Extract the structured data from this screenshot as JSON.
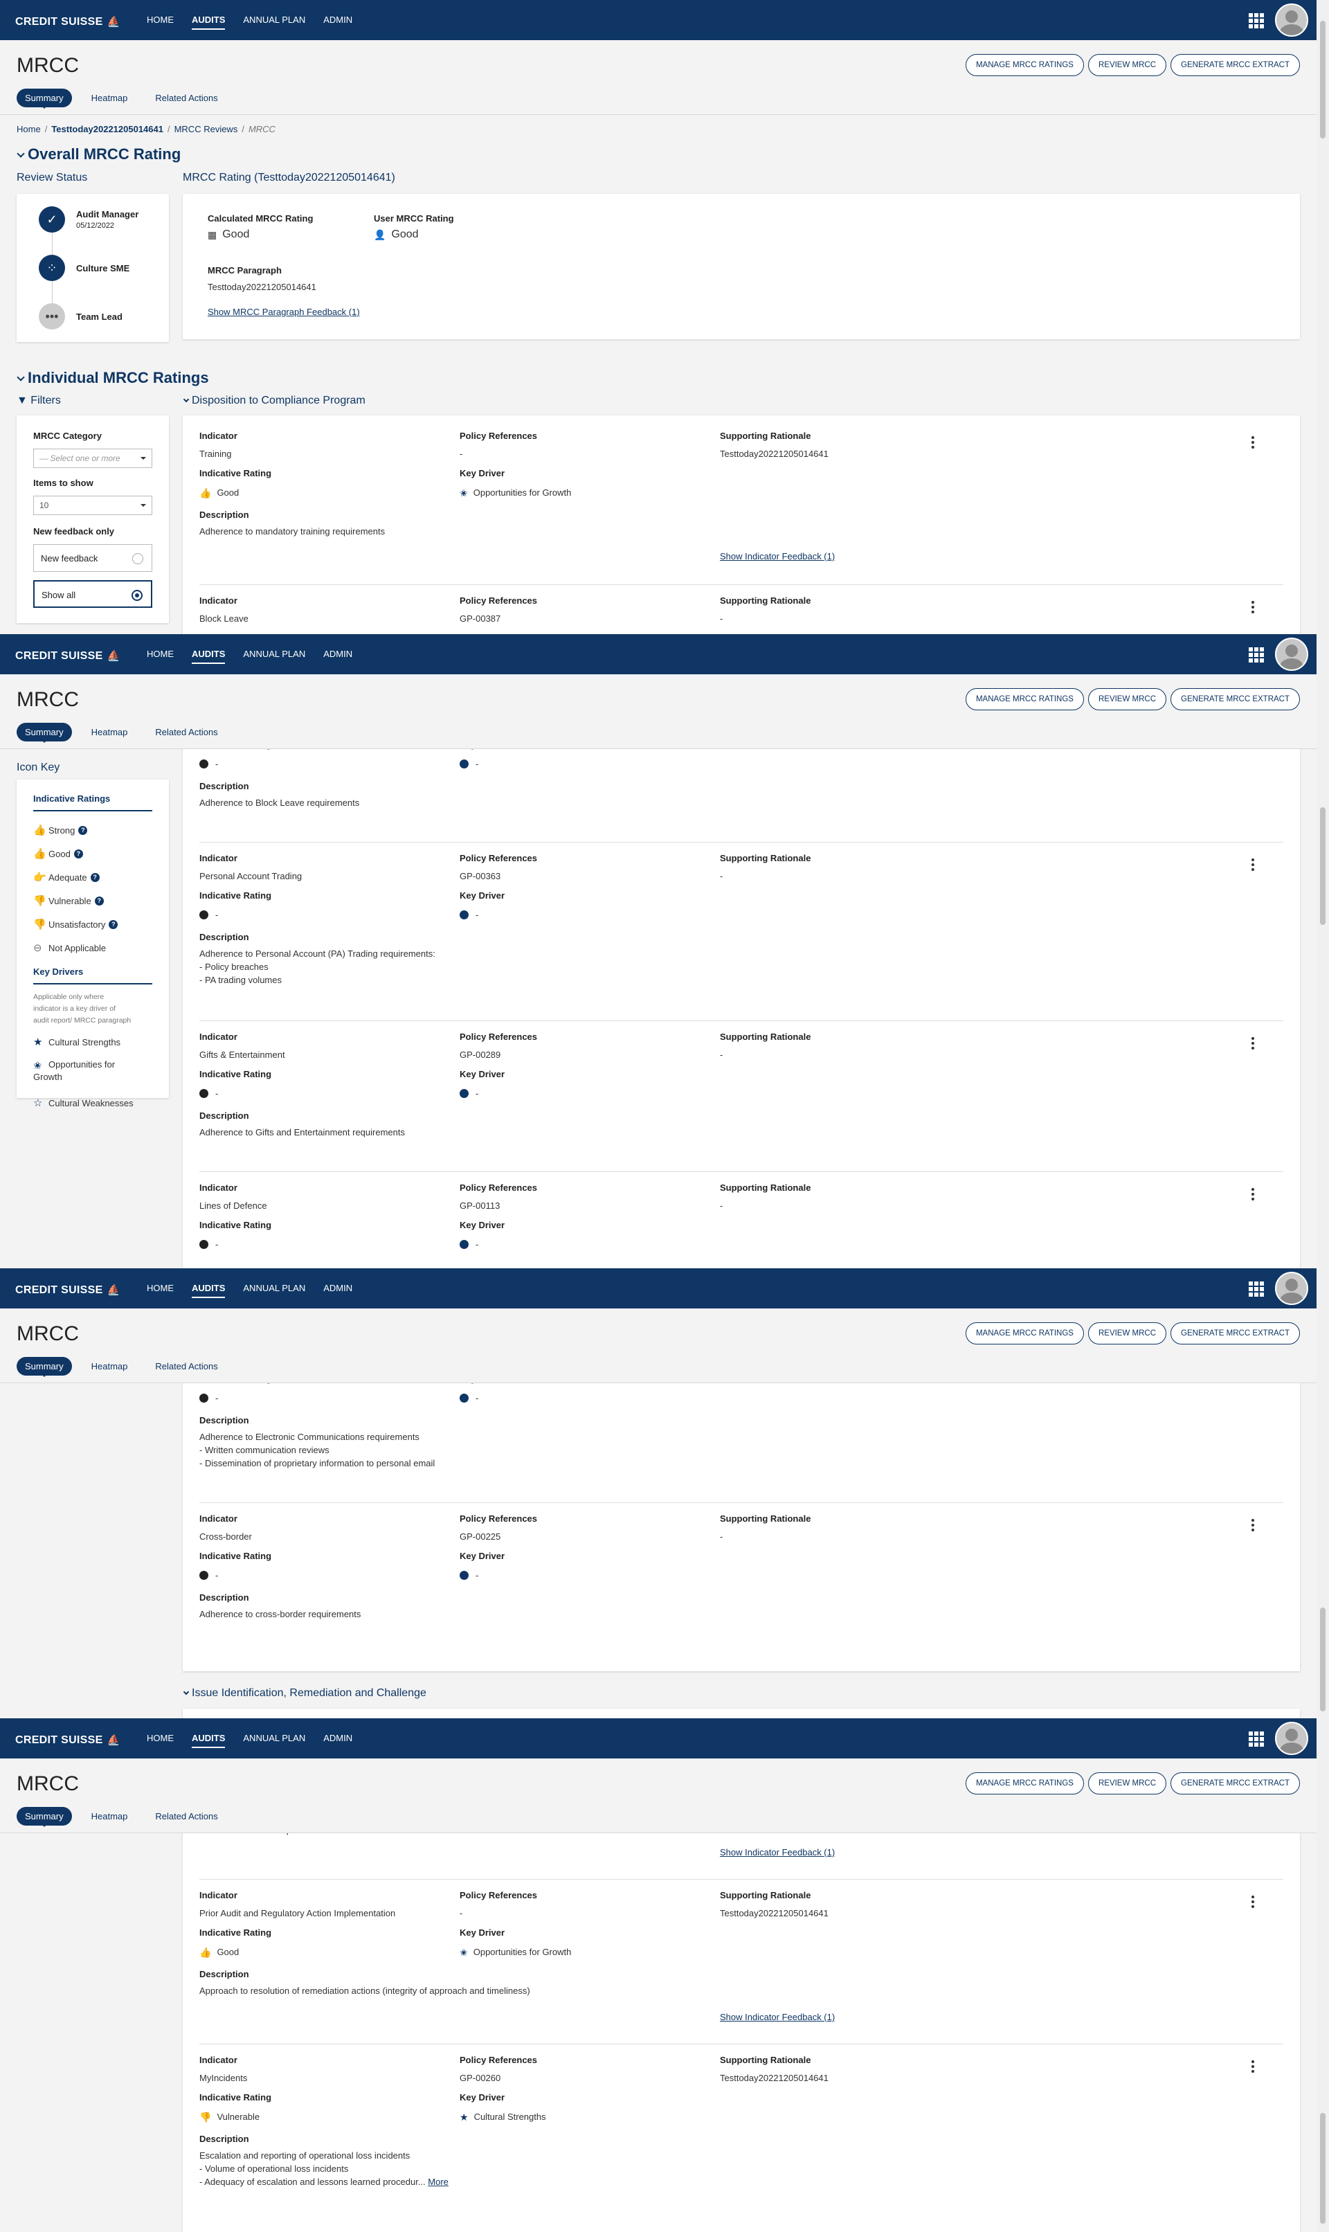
{
  "header": {
    "brand": "CREDIT SUISSE",
    "nav": [
      "HOME",
      "AUDITS",
      "ANNUAL PLAN",
      "ADMIN"
    ],
    "active_nav": "AUDITS"
  },
  "page": {
    "title": "MRCC",
    "actions": [
      "MANAGE MRCC RATINGS",
      "REVIEW MRCC",
      "GENERATE MRCC EXTRACT"
    ],
    "tabs": [
      "Summary",
      "Heatmap",
      "Related Actions"
    ]
  },
  "breadcrumb": {
    "home": "Home",
    "audit": "Testtoday20221205014641",
    "reviews": "MRCC Reviews",
    "current": "MRCC"
  },
  "overall": {
    "heading": "Overall MRCC Rating",
    "review_status": "Review Status",
    "rating_title": "MRCC Rating (Testtoday20221205014641)",
    "steps": [
      {
        "name": "Audit Manager",
        "date": "05/12/2022"
      },
      {
        "name": "Culture SME"
      },
      {
        "name": "Team Lead"
      }
    ],
    "calc_label": "Calculated MRCC Rating",
    "calc_value": "Good",
    "user_label": "User MRCC Rating",
    "user_value": "Good",
    "para_label": "MRCC Paragraph",
    "para_value": "Testtoday20221205014641",
    "feedback_link": "Show MRCC Paragraph Feedback (1)"
  },
  "individual": {
    "heading": "Individual MRCC Ratings",
    "filters": "Filters",
    "group1": "Disposition to Compliance Program",
    "group2": "Issue Identification, Remediation and Challenge"
  },
  "filters": {
    "category_label": "MRCC Category",
    "category_placeholder": "— Select one or more",
    "items_label": "Items to show",
    "items_value": "10",
    "feedback_label": "New feedback only",
    "opt_new": "New feedback",
    "opt_all": "Show all"
  },
  "labels": {
    "indicator": "Indicator",
    "policy": "Policy References",
    "rationale": "Supporting Rationale",
    "rating": "Indicative Rating",
    "driver": "Key Driver",
    "description": "Description",
    "feedback": "Show Indicator Feedback (1)",
    "dash": "-",
    "more": "More"
  },
  "icon_key": {
    "title": "Icon Key",
    "ratings_hdr": "Indicative Ratings",
    "ratings": [
      "Strong",
      "Good",
      "Adequate",
      "Vulnerable",
      "Unsatisfactory",
      "Not Applicable"
    ],
    "drivers_hdr": "Key Drivers",
    "drivers_note": [
      "Applicable only where",
      "indicator is a key driver of",
      "audit report/ MRCC paragraph"
    ],
    "drivers": [
      "Cultural Strengths",
      "Opportunities for",
      "Growth",
      "Cultural Weaknesses"
    ]
  },
  "indicators": {
    "training": {
      "name": "Training",
      "policy": "-",
      "rationale": "Testtoday20221205014641",
      "rating": "Good",
      "driver": "Opportunities for Growth",
      "desc": "Adherence to mandatory training requirements"
    },
    "block": {
      "name": "Block Leave",
      "policy": "GP-00387",
      "rationale": "-",
      "desc": "Adherence to Block Leave requirements"
    },
    "pa": {
      "name": "Personal Account Trading",
      "policy": "GP-00363",
      "rationale": "-",
      "desc1": "Adherence to Personal Account (PA) Trading requirements:",
      "desc2": "- Policy breaches",
      "desc3": "- PA trading volumes"
    },
    "gifts": {
      "name": "Gifts & Entertainment",
      "policy": "GP-00289",
      "rationale": "-",
      "desc": "Adherence to Gifts and Entertainment requirements"
    },
    "lod": {
      "name": "Lines of Defence",
      "policy": "GP-00113",
      "rationale": "-"
    },
    "ecomm": {
      "desc1": "Adherence to Electronic Communications requirements",
      "desc2": "- Written communication reviews",
      "desc3": "- Dissemination of proprietary information to personal email"
    },
    "cross": {
      "name": "Cross-border",
      "policy": "GP-00225",
      "rationale": "-",
      "desc": "Adherence to cross-border requirements"
    },
    "prev_tail": "business/ function/ department",
    "prior": {
      "name": "Prior Audit and Regulatory Action Implementation",
      "policy": "-",
      "rationale": "Testtoday20221205014641",
      "rating": "Good",
      "driver": "Opportunities for Growth",
      "desc": "Approach to resolution of remediation actions (integrity of approach and timeliness)"
    },
    "myinc": {
      "name": "MyIncidents",
      "policy": "GP-00260",
      "rationale": "Testtoday20221205014641",
      "rating": "Vulnerable",
      "driver": "Cultural Strengths",
      "desc1": "Escalation and reporting of operational loss incidents",
      "desc2": "- Volume of operational loss incidents",
      "desc3": "- Adequacy of escalation and lessons learned procedur..."
    }
  },
  "colors": {
    "brand": "#0f3664",
    "good": "#2e9e2e",
    "bad": "#d0163c"
  }
}
